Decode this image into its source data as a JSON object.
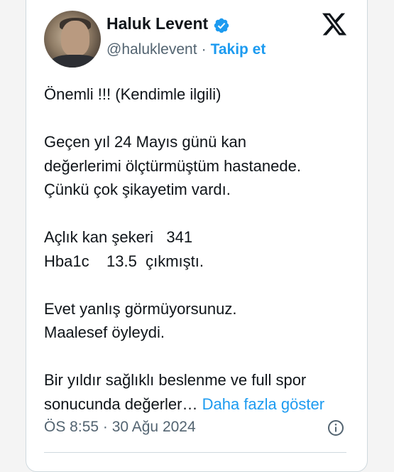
{
  "author": {
    "name": "Haluk Levent",
    "handle": "@haluklevent",
    "separator": "·",
    "follow_label": "Takip et"
  },
  "icons": {
    "verified": "verified-badge-icon",
    "platform": "x-logo-icon",
    "info": "info-icon"
  },
  "colors": {
    "accent": "#1d9bf0",
    "text": "#0f1419",
    "secondary": "#536471"
  },
  "tweet": {
    "lines": [
      "Önemli !!! (Kendimle ilgili)",
      "",
      "Geçen yıl 24 Mayıs günü kan",
      "değerlerimi ölçtürmüştüm hastanede.",
      "Çünkü çok şikayetim vardı.",
      "",
      "Açlık kan şekeri   341",
      "Hba1c    13.5  çıkmıştı.",
      "",
      "Evet yanlış görmüyorsunuz.",
      "Maalesef öyleydi.",
      "",
      "Bir yıldır sağlıklı beslenme ve full spor"
    ],
    "last_line": "sonucunda değerler…",
    "show_more_label": "Daha fazla göster"
  },
  "meta": {
    "timestamp": "ÖS 8:55 · 30 Ağu 2024"
  }
}
